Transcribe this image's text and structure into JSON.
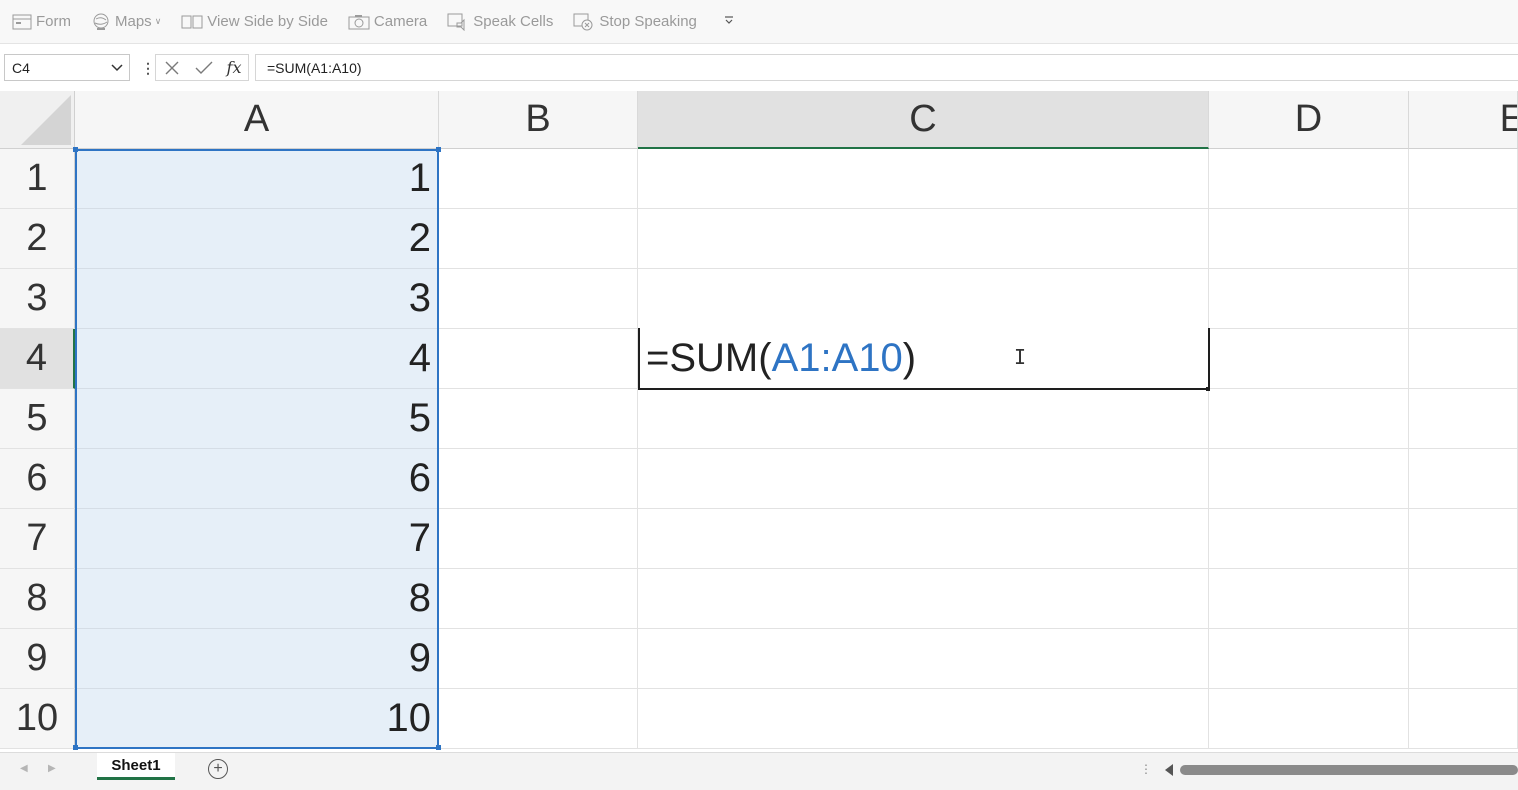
{
  "qat": {
    "items": [
      {
        "label": "Form",
        "icon": "form-icon"
      },
      {
        "label": "Maps",
        "icon": "maps-icon"
      },
      {
        "label": "View Side by Side",
        "icon": "view-side-by-side-icon"
      },
      {
        "label": "Camera",
        "icon": "camera-icon"
      },
      {
        "label": "Speak Cells",
        "icon": "speak-cells-icon"
      },
      {
        "label": "Stop Speaking",
        "icon": "stop-speaking-icon"
      }
    ]
  },
  "formula_bar": {
    "name_box": "C4",
    "formula": "=SUM(A1:A10)"
  },
  "grid": {
    "columns": [
      "A",
      "B",
      "C",
      "D",
      "E"
    ],
    "selected_column": "C",
    "rows": [
      "1",
      "2",
      "3",
      "4",
      "5",
      "6",
      "7",
      "8",
      "9",
      "10"
    ],
    "selected_row": "4",
    "column_a_values": [
      "1",
      "2",
      "3",
      "4",
      "5",
      "6",
      "7",
      "8",
      "9",
      "10"
    ],
    "active_cell": {
      "prefix": "=SUM(",
      "reference": "A1:A10",
      "suffix": ")"
    }
  },
  "sheets": {
    "tabs": [
      "Sheet1"
    ],
    "active": "Sheet1"
  },
  "colors": {
    "range_highlight": "#2e74c4",
    "range_fill": "#e6eff8",
    "excel_green": "#217346"
  }
}
